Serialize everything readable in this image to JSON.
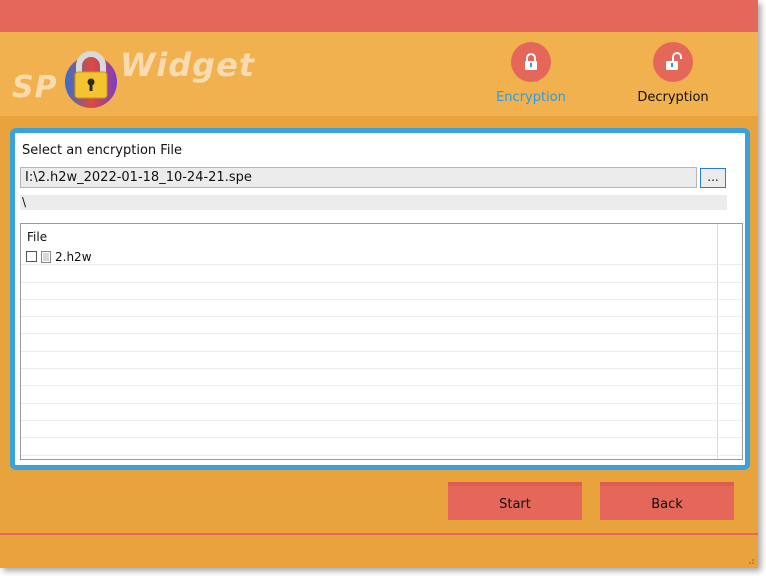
{
  "app": {
    "logo_left": "SP",
    "logo_right": "Widget"
  },
  "modes": {
    "encryption_label": "Encryption",
    "decryption_label": "Decryption"
  },
  "select": {
    "label": "Select an encryption File",
    "path_value": "I:\\2.h2w_2022-01-18_10-24-21.spe",
    "browse_label": "...",
    "current_dir": "\\"
  },
  "file_list": {
    "header": "File",
    "files": [
      {
        "name": "2.h2w",
        "checked": false
      }
    ]
  },
  "footer": {
    "start_label": "Start",
    "back_label": "Back"
  },
  "colors": {
    "title_bar": "#e5675a",
    "header_bg": "#f1b14e",
    "body_bg": "#e8a33c",
    "panel_border": "#3aa1df",
    "active_mode_text": "#2b9ce3",
    "button_bg": "#e5675a"
  }
}
